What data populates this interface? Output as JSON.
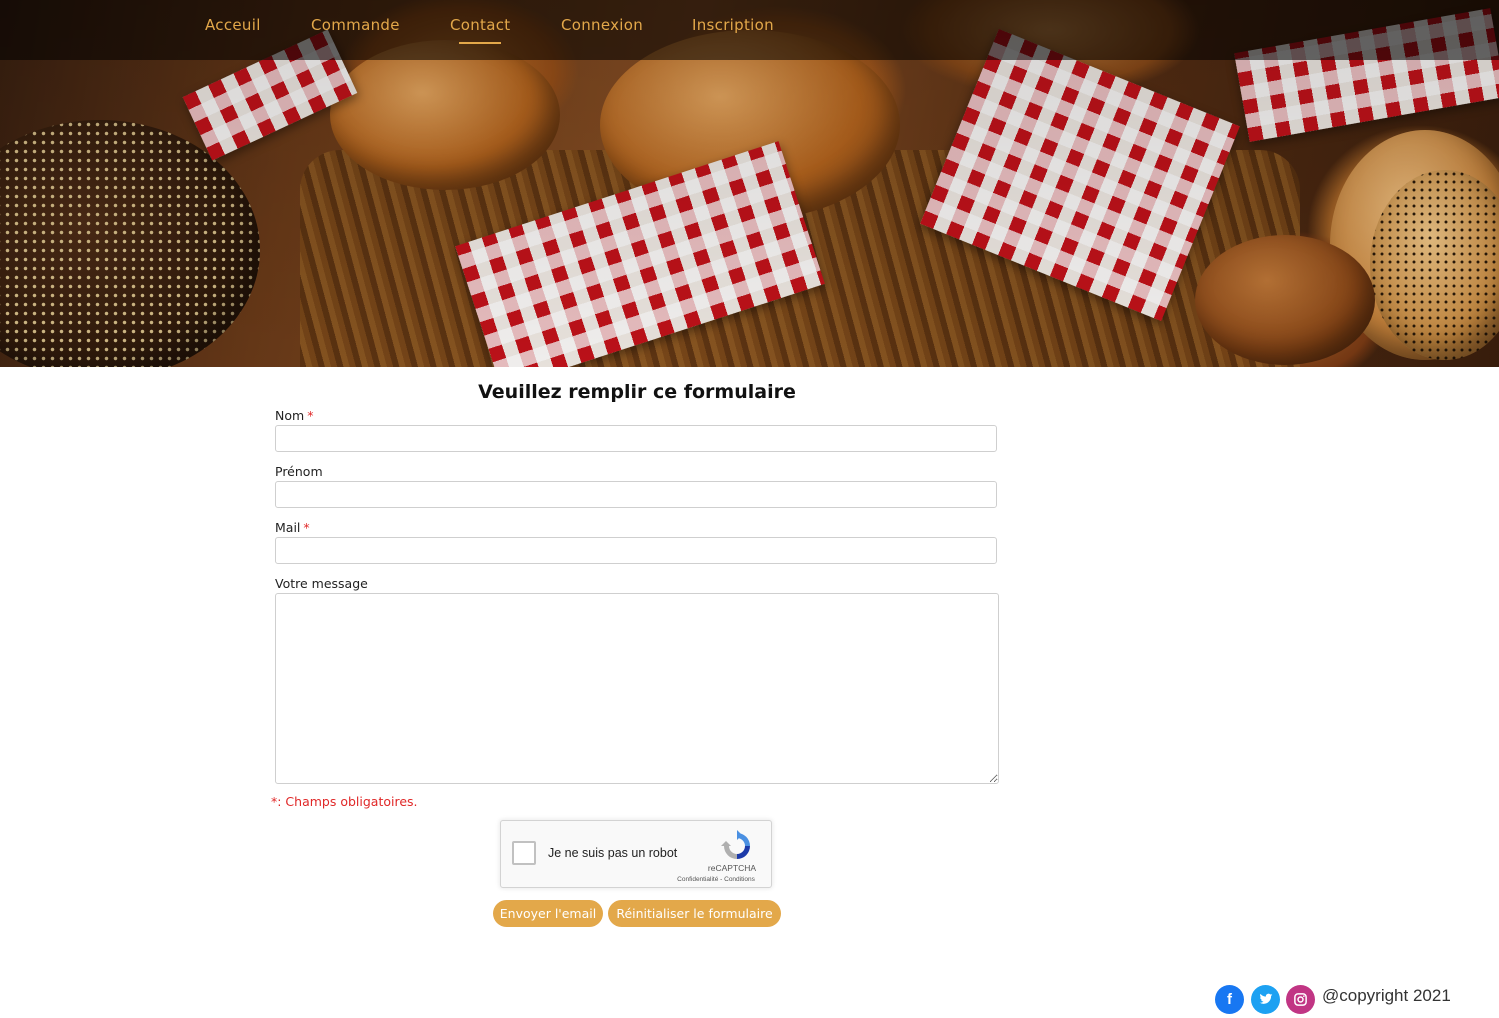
{
  "nav": {
    "items": [
      {
        "label": "Acceuil",
        "active": false
      },
      {
        "label": "Commande",
        "active": false
      },
      {
        "label": "Contact",
        "active": true
      },
      {
        "label": "Connexion",
        "active": false
      },
      {
        "label": "Inscription",
        "active": false
      }
    ]
  },
  "form": {
    "title": "Veuillez remplir ce formulaire",
    "fields": {
      "nom": {
        "label": "Nom",
        "required_mark": "*",
        "value": ""
      },
      "prenom": {
        "label": "Prénom",
        "value": ""
      },
      "mail": {
        "label": "Mail",
        "required_mark": "*",
        "value": ""
      },
      "message": {
        "label": "Votre message",
        "value": ""
      }
    },
    "required_note": "*: Champs obligatoires.",
    "captcha": {
      "label": "Je ne suis pas un robot",
      "brand": "reCAPTCHA",
      "links": "Confidentialité - Conditions",
      "checked": false
    },
    "buttons": {
      "send": "Envoyer l'email",
      "reset": "Réinitialiser le formulaire"
    }
  },
  "footer": {
    "social": [
      {
        "name": "facebook",
        "glyph": "f",
        "color": "#1877f2"
      },
      {
        "name": "twitter",
        "glyph": "t",
        "color": "#1da1f2"
      },
      {
        "name": "instagram",
        "glyph": "◎",
        "color": "#c13584"
      }
    ],
    "copyright": "@copyright 2021"
  },
  "colors": {
    "accent": "#e3a84a",
    "nav_text": "#e3a84a",
    "required": "#e02828"
  }
}
